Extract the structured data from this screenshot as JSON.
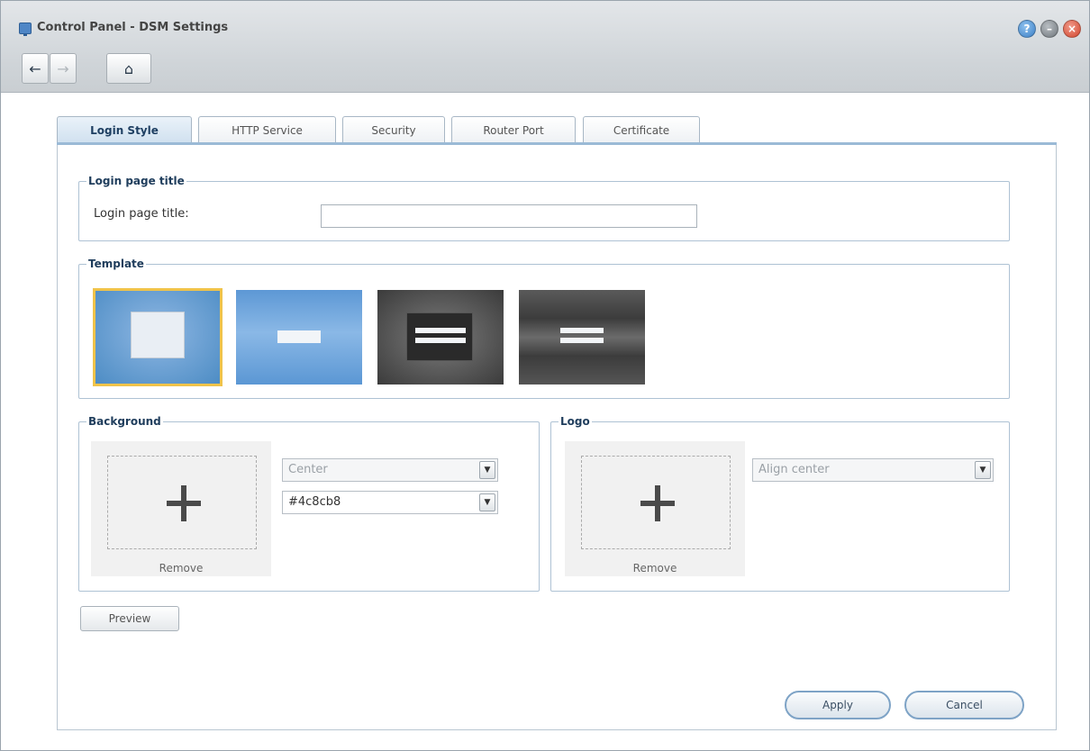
{
  "window": {
    "title": "Control Panel - DSM Settings",
    "accent": "#4c8cc4"
  },
  "toolbar": {
    "back_icon": "arrow-left-icon",
    "forward_icon": "arrow-right-icon",
    "home_icon": "home-icon"
  },
  "tabs": [
    {
      "label": "Login Style",
      "active": true
    },
    {
      "label": "HTTP Service",
      "active": false
    },
    {
      "label": "Security",
      "active": false
    },
    {
      "label": "Router Port",
      "active": false
    },
    {
      "label": "Certificate",
      "active": false
    }
  ],
  "login_title": {
    "legend": "Login page title",
    "label": "Login page title:",
    "value": ""
  },
  "template": {
    "legend": "Template",
    "selected_index": 0
  },
  "background": {
    "legend": "Background",
    "remove": "Remove",
    "position": "Center",
    "color": "#4c8cb8"
  },
  "logo": {
    "legend": "Logo",
    "remove": "Remove",
    "align": "Align center"
  },
  "buttons": {
    "preview": "Preview",
    "apply": "Apply",
    "cancel": "Cancel"
  }
}
